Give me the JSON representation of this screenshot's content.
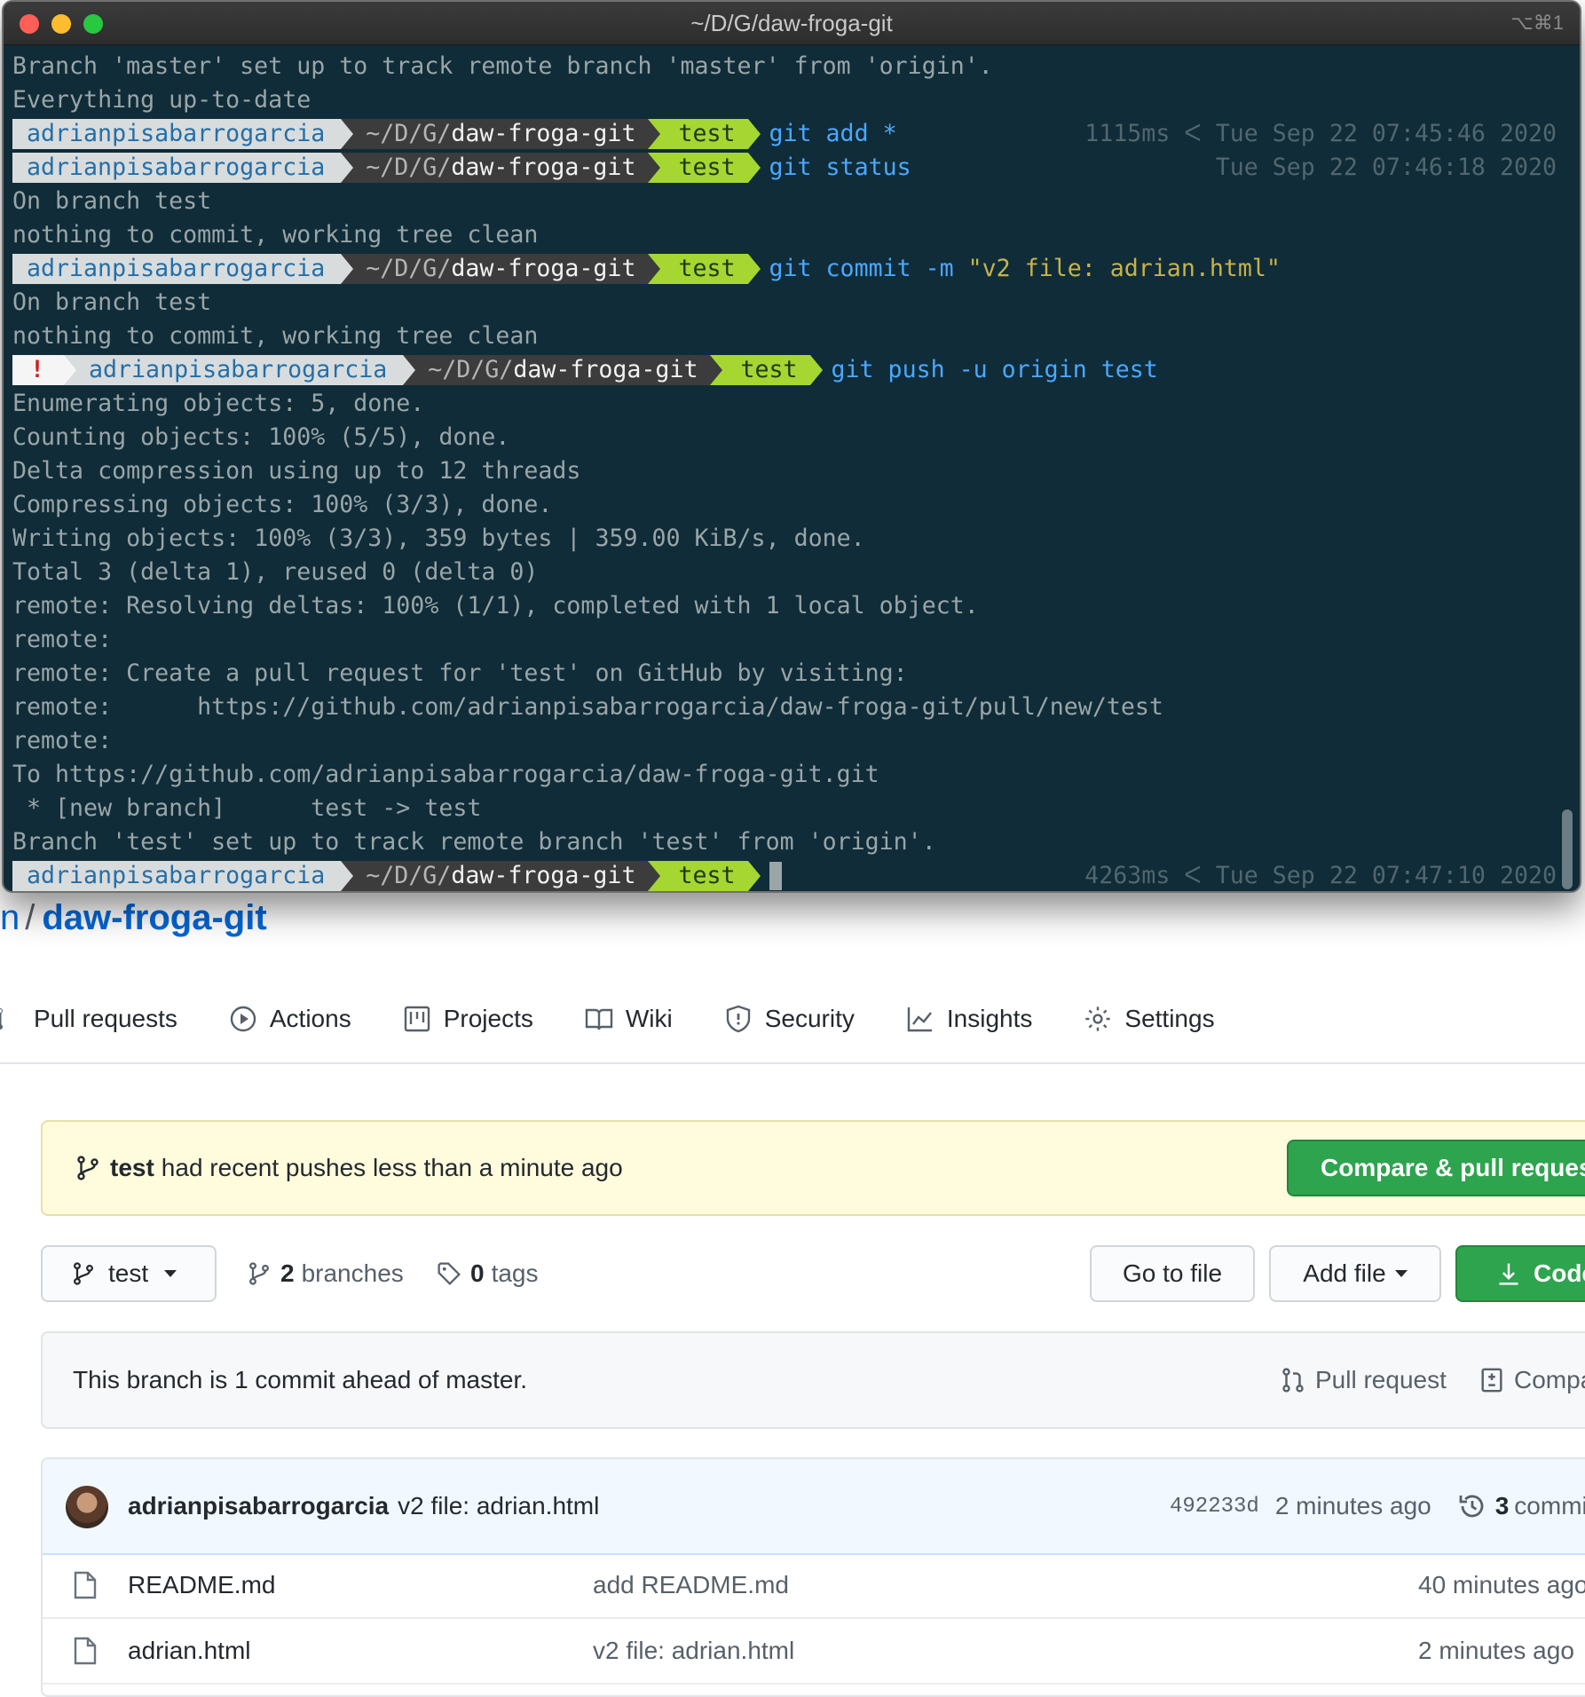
{
  "terminal": {
    "title": "~/D/G/daw-froga-git",
    "shortcut": "⌥⌘1",
    "prompt": {
      "user": "adrianpisabarrogarcia",
      "path_prefix": "~/D/G/",
      "path_dir": "daw-froga-git",
      "branch": "test",
      "branch_icon": "",
      "error_mark": "!"
    },
    "lines": {
      "l0": "Branch 'master' set up to track remote branch 'master' from 'origin'.",
      "l1": "Everything up-to-date",
      "cmd_add": "git add *",
      "rp_add": "1115ms ᐸ Tue Sep 22 07:45:46 2020",
      "cmd_status": "git status",
      "rp_status": "Tue Sep 22 07:46:18 2020",
      "l4": "On branch test",
      "l5": "nothing to commit, working tree clean",
      "cmd_commit": "git commit -m ",
      "cmd_commit_str": "\"v2 file: adrian.html\"",
      "l7": "On branch test",
      "l8": "nothing to commit, working tree clean",
      "cmd_push": "git push -u origin test",
      "l10": "Enumerating objects: 5, done.",
      "l11": "Counting objects: 100% (5/5), done.",
      "l12": "Delta compression using up to 12 threads",
      "l13": "Compressing objects: 100% (3/3), done.",
      "l14": "Writing objects: 100% (3/3), 359 bytes | 359.00 KiB/s, done.",
      "l15": "Total 3 (delta 1), reused 0 (delta 0)",
      "l16": "remote: Resolving deltas: 100% (1/1), completed with 1 local object.",
      "l17": "remote:",
      "l18": "remote: Create a pull request for 'test' on GitHub by visiting:",
      "l19": "remote:      https://github.com/adrianpisabarrogarcia/daw-froga-git/pull/new/test",
      "l20": "remote:",
      "l21": "To https://github.com/adrianpisabarrogarcia/daw-froga-git.git",
      "l22": " * [new branch]      test -> test",
      "l23": "Branch 'test' set up to track remote branch 'test' from 'origin'.",
      "rp_last": "4263ms ᐸ Tue Sep 22 07:47:10 2020"
    }
  },
  "github": {
    "repo_owner_tail": "n",
    "repo_sep": "/",
    "repo_name": "daw-froga-git",
    "tabs": [
      {
        "label": "Pull requests",
        "icon": "pull-request-icon"
      },
      {
        "label": "Actions",
        "icon": "play-icon"
      },
      {
        "label": "Projects",
        "icon": "project-icon"
      },
      {
        "label": "Wiki",
        "icon": "book-icon"
      },
      {
        "label": "Security",
        "icon": "shield-icon"
      },
      {
        "label": "Insights",
        "icon": "graph-icon"
      },
      {
        "label": "Settings",
        "icon": "gear-icon"
      }
    ],
    "push_banner": {
      "branch": "test",
      "text": "had recent pushes less than a minute ago",
      "button": "Compare & pull request"
    },
    "toolbar": {
      "branch": "test",
      "branches_count": "2",
      "branches_label": "branches",
      "tags_count": "0",
      "tags_label": "tags",
      "go_to_file": "Go to file",
      "add_file": "Add file",
      "code": "Code"
    },
    "ahead": {
      "text": "This branch is 1 commit ahead of master.",
      "pull_request": "Pull request",
      "compare": "Compare"
    },
    "latest_commit": {
      "author": "adrianpisabarrogarcia",
      "message": "v2 file: adrian.html",
      "sha": "492233d",
      "age": "2 minutes ago",
      "commits_count": "3",
      "commits_label": "commits"
    },
    "files": [
      {
        "name": "README.md",
        "message": "add README.md",
        "age": "40 minutes ago"
      },
      {
        "name": "adrian.html",
        "message": "v2 file: adrian.html",
        "age": "2 minutes ago"
      }
    ]
  }
}
